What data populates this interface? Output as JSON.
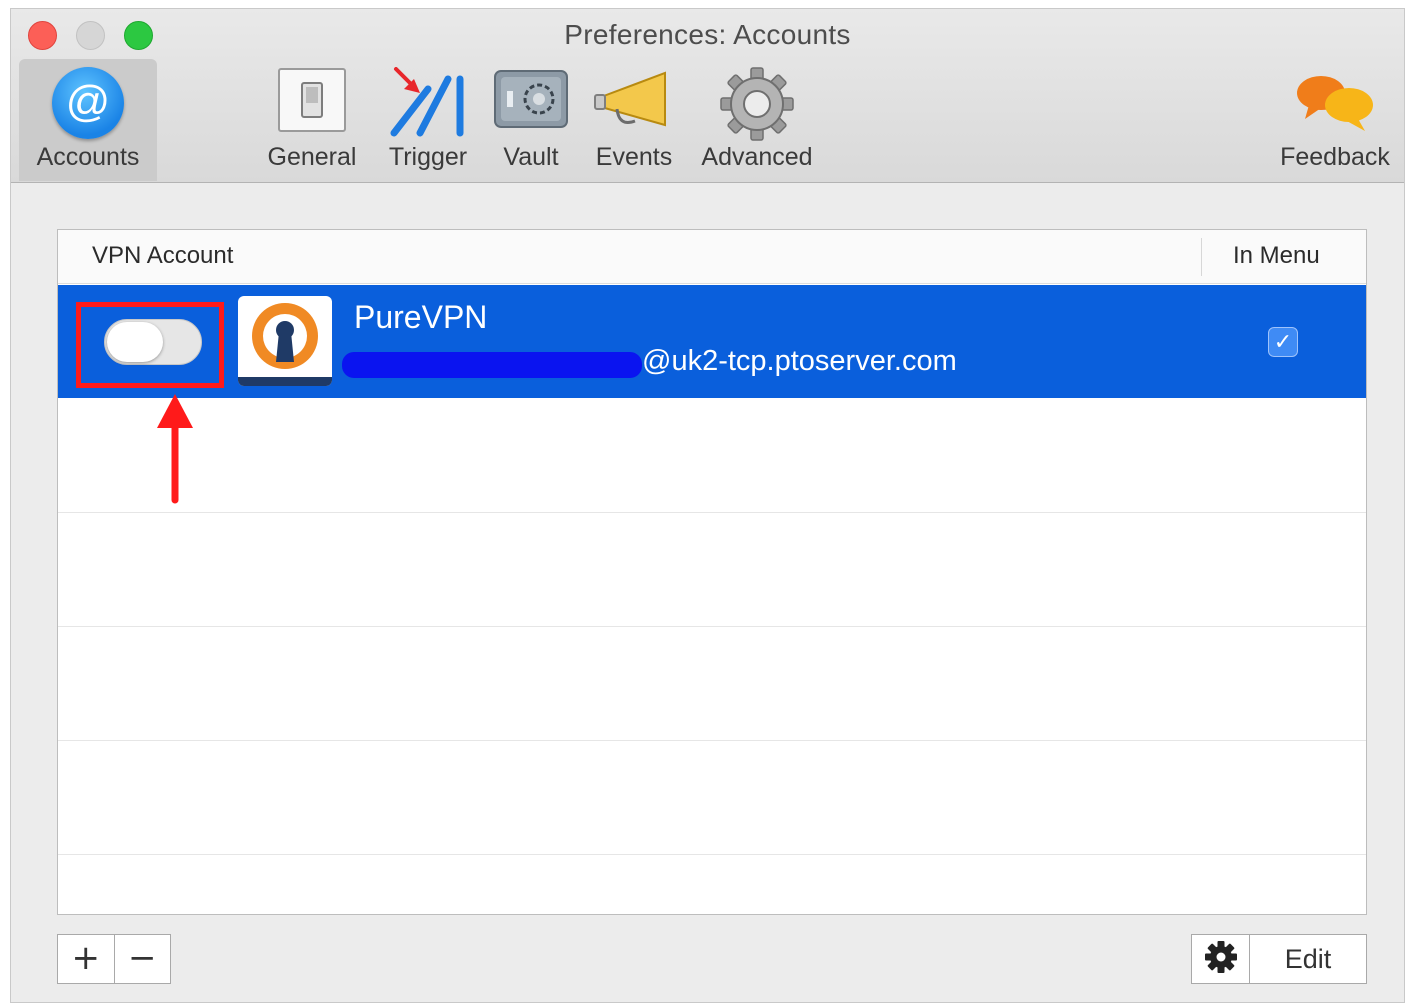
{
  "window": {
    "title": "Preferences: Accounts"
  },
  "toolbar": {
    "items": [
      {
        "label": "Accounts",
        "icon": "at-sign-icon",
        "selected": true
      },
      {
        "label": "General",
        "icon": "switch-icon",
        "selected": false
      },
      {
        "label": "Trigger",
        "icon": "trigger-icon",
        "selected": false
      },
      {
        "label": "Vault",
        "icon": "vault-icon",
        "selected": false
      },
      {
        "label": "Events",
        "icon": "megaphone-icon",
        "selected": false
      },
      {
        "label": "Advanced",
        "icon": "gear-icon",
        "selected": false
      }
    ],
    "feedback": {
      "label": "Feedback",
      "icon": "chat-bubbles-icon"
    }
  },
  "table": {
    "columns": [
      "VPN Account",
      "In Menu"
    ],
    "rows": [
      {
        "name": "PureVPN",
        "server": "@uk2-tcp.ptoserver.com",
        "enabled": false,
        "in_menu": true,
        "icon": "openvpn-icon",
        "checkmark": "✓"
      }
    ]
  },
  "footer": {
    "add_label": "+",
    "remove_label": "−",
    "edit_label": "Edit"
  },
  "colors": {
    "selection": "#0a5fdc",
    "annotation": "#ff1a1a",
    "accent": "#1a83e6"
  }
}
